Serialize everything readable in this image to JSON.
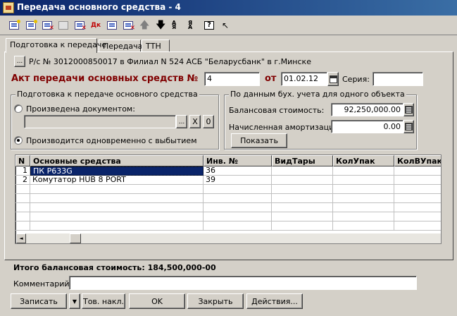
{
  "window": {
    "title": "Передача основного средства - 4"
  },
  "toolbar": {
    "buttons": [
      {
        "name": "toolbar-new-icon"
      },
      {
        "name": "toolbar-copy-icon"
      },
      {
        "name": "toolbar-delete-icon"
      },
      {
        "name": "toolbar-copy-grey-icon"
      },
      {
        "name": "toolbar-dt-icon"
      },
      {
        "name": "toolbar-dk-icon"
      },
      {
        "name": "toolbar-filter-icon"
      },
      {
        "name": "toolbar-subtotal-icon"
      },
      {
        "name": "toolbar-up-icon"
      },
      {
        "name": "toolbar-down-icon"
      },
      {
        "name": "toolbar-sort-asc-icon"
      },
      {
        "name": "toolbar-sort-desc-icon"
      },
      {
        "name": "toolbar-help-icon"
      },
      {
        "name": "toolbar-context-help-icon"
      }
    ],
    "dk_label": "Дк",
    "sort_asc": "А\nЯ",
    "sort_desc": "Я\nА",
    "help": "?"
  },
  "tabs": [
    {
      "label": "Подготовка к передаче",
      "active": true
    },
    {
      "label": "Передача",
      "active": false
    },
    {
      "label": "ТТН",
      "active": false
    }
  ],
  "account": {
    "button_label": "...",
    "text": "Р/с № 3012000850017 в Филиал N 524 АСБ \"Беларусбанк\" в г.Минске"
  },
  "act": {
    "title": "Акт передачи основных средств №",
    "number": "4",
    "date_label": "от",
    "date": "01.02.12",
    "series_label": "Серия:",
    "series": ""
  },
  "preparation": {
    "group_title": "Подготовка к передаче основного средства",
    "option_document": "Произведена документом:",
    "document_value": "",
    "ellipsis": "...",
    "clear": "X",
    "zero": "0",
    "option_simultaneous": "Производится одновременно с выбытием",
    "selected": "simultaneous"
  },
  "accounting": {
    "group_title": "По данным бух. учета для одного объекта",
    "balance_label": "Балансовая стоимость:",
    "balance_value": "92,250,000.00",
    "depreciation_label": "Начисленная амортизация:",
    "depreciation_value": "0.00",
    "show_button": "Показать"
  },
  "grid": {
    "columns": [
      "N",
      "Основные средства",
      "Инв. №",
      "ВидТары",
      "КолУпак",
      "КолВУпак"
    ],
    "rows": [
      {
        "n": "1",
        "asset": "ПК P633G",
        "inv": "36",
        "tare": "",
        "qty_pack": "",
        "qty_in_pack": ""
      },
      {
        "n": "2",
        "asset": "Комутатор HUB 8 PORT",
        "inv": "39",
        "tare": "",
        "qty_pack": "",
        "qty_in_pack": ""
      }
    ],
    "scroll_left": "◄"
  },
  "total": {
    "text": "Итого балансовая стоимость: 184,500,000-00"
  },
  "comment": {
    "label": "Комментарий:",
    "value": ""
  },
  "footer": {
    "save": "Записать",
    "menu_arrow": "▼",
    "invoice": "Тов. накл.",
    "ok": "OK",
    "close": "Закрыть",
    "actions": "Действия..."
  }
}
